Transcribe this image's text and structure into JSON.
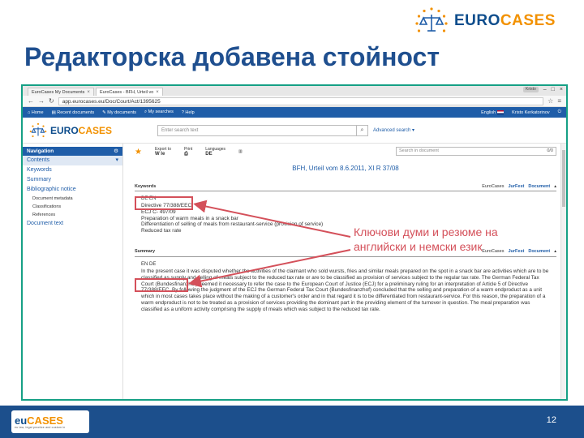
{
  "slide": {
    "logo_text_primary": "EURO",
    "logo_text_accent": "CASES",
    "title": "Редакторска добавена стойност",
    "page_number": "12",
    "footer_logo_main": "eu",
    "footer_logo_accent": "CASES",
    "footer_logo_sub": "eu law, legal practice and custom in"
  },
  "browser": {
    "tabs": [
      {
        "label": "EuroCases My Documents",
        "active": false
      },
      {
        "label": "EuroCases - BFH, Urteil vo",
        "active": true
      }
    ],
    "url": "app.eurocases.eu/Doc/Court/Act/1395625",
    "user_chip": "Kristo"
  },
  "app_nav": {
    "items": [
      "Home",
      "Recent documents",
      "My documents",
      "My searches",
      "Help"
    ],
    "language": "English",
    "user": "Kristo Kerkatorinov"
  },
  "header": {
    "logo_primary": "EURO",
    "logo_accent": "CASES",
    "search_placeholder": "Enter search text",
    "advanced_search": "Advanced search"
  },
  "sidebar": {
    "heading": "Navigation",
    "heading_icon": "gear-icon",
    "items": [
      {
        "label": "Contents",
        "type": "selected"
      },
      {
        "label": "Keywords",
        "type": "item"
      },
      {
        "label": "Summary",
        "type": "item"
      },
      {
        "label": "Bibliographic notice",
        "type": "item"
      },
      {
        "label": "Document metadata",
        "type": "sub"
      },
      {
        "label": "Classifications",
        "type": "sub"
      },
      {
        "label": "References",
        "type": "sub"
      },
      {
        "label": "Document text",
        "type": "item"
      }
    ]
  },
  "toolbar": {
    "export_label": "Export to",
    "export_value": "W  Ie",
    "print_label": "Print",
    "languages_label": "Languages",
    "languages_value": "DE",
    "search_in_doc": "Search in document",
    "search_count": "0/0"
  },
  "document": {
    "title": "BFH, Urteil vom 8.6.2011, XI R 37/08",
    "keywords_label": "Keywords",
    "summary_label": "Summary",
    "source_items": [
      "EuroCases",
      "JurFest",
      "Document"
    ],
    "keywords_langs": "DE  EN",
    "keywords_lines": [
      "Directive 77/388/EEC",
      "ECJ  C- 497/09",
      "Preparation of warm meals in a snack bar",
      "Differentiation of selling of meals from restaurant-service (provision of service)",
      "Reduced tax rate"
    ],
    "summary_langs": "EN  DE",
    "summary_text": "In the present case it was disputed whether the activities of the claimant who sold wursts, fries and similar meals prepared on the spot in a snack bar are activities which are to be classified as supply and selling of meals subject to the reduced tax rate or are to be classified as provision of services subject to the regular tax rate. The German Federal Tax Court (Bundesfinanzhof) deemed it necessary to refer the case to the European Court of Justice (ECJ) for a preliminary ruling for an interpretation of Article 5 of Directive 77/388/EEC. By following the judgment of the ECJ the German Federal Tax Court (Bundesfinanzhof) concluded that the selling and preparation of a warm endproduct as a unit which in most cases takes place without the making of a customer's order and in that regard it is to be differentiated from restaurant-service. For this reason, the preparation of a warm endproduct is not to be treated as a provision of services providing the dominant part in the providing element of the turnover in question. The meal preparation was classified as a uniform activity comprising the supply of meals which was subject to the reduced tax rate."
  },
  "callout": {
    "line1": "Ключови думи и резюме на",
    "line2": "английски и немски език"
  },
  "colors": {
    "accent": "#d4505a",
    "brand_blue": "#1f5da8",
    "brand_orange": "#f29100",
    "footer": "#1c4f8c",
    "frame": "#16a085"
  }
}
